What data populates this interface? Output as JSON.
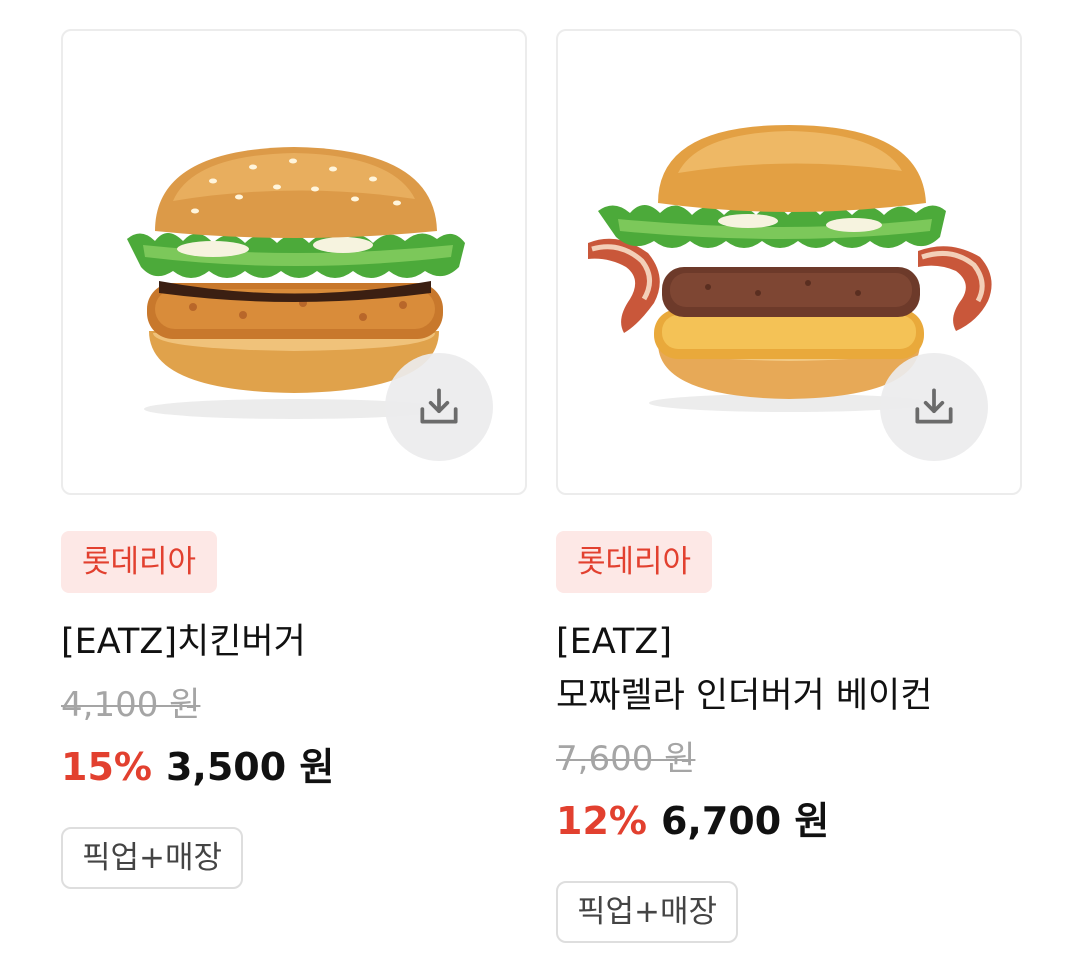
{
  "products": [
    {
      "brand": "롯데리아",
      "name": "[EATZ]치킨버거",
      "original_price": "4,100 원",
      "discount": "15%",
      "price": "3,500 원",
      "tag": "픽업+매장",
      "image_icon": "chicken-burger-image",
      "download_icon": "download-icon"
    },
    {
      "brand": "롯데리아",
      "name_line1": "[EATZ]",
      "name_line2": "모짜렐라 인더버거 베이컨",
      "original_price": "7,600 원",
      "discount": "12%",
      "price": "6,700 원",
      "tag": "픽업+매장",
      "image_icon": "bacon-burger-image",
      "download_icon": "download-icon"
    }
  ],
  "colors": {
    "accent": "#e2402f",
    "brand_bg": "#fde8e6",
    "strike": "#a5a5a5",
    "border": "#ececec"
  }
}
